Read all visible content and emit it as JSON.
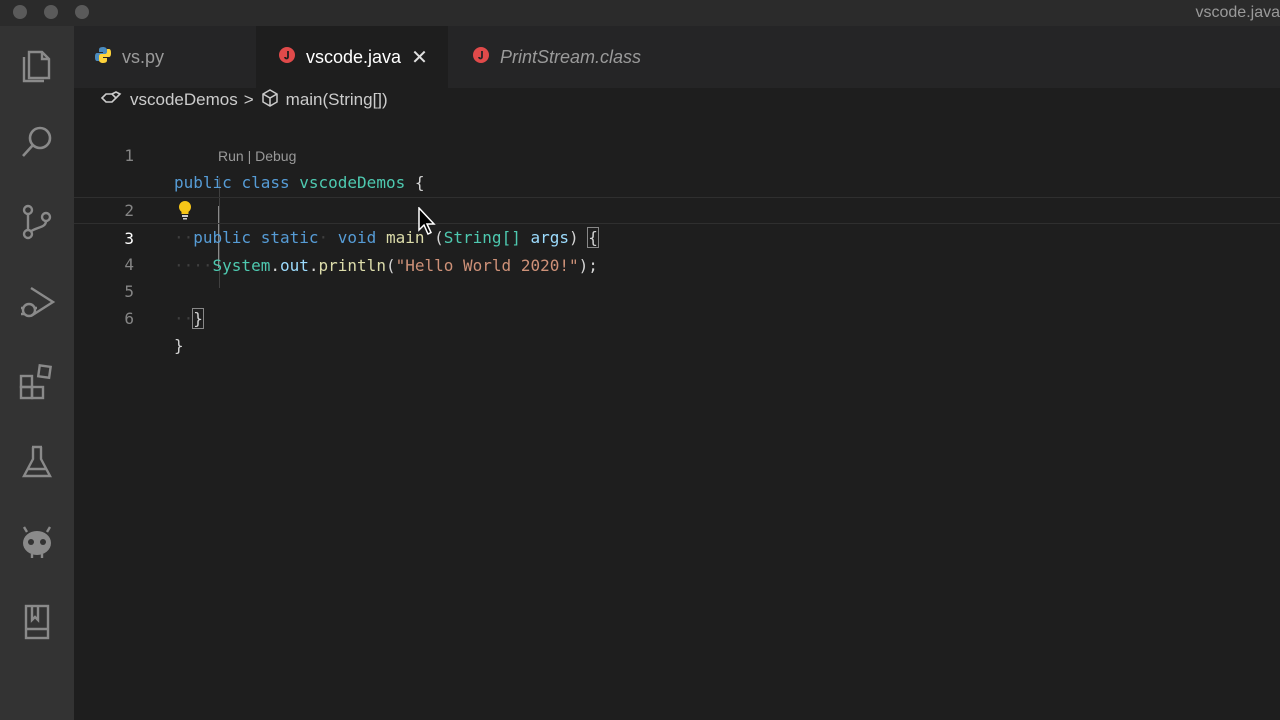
{
  "window": {
    "title": "vscode.java"
  },
  "activity_bar": {
    "icons": [
      "files-icon",
      "search-icon",
      "source-control-icon",
      "run-debug-icon",
      "extensions-icon",
      "testing-icon",
      "robot-icon",
      "book-icon"
    ]
  },
  "tabs": [
    {
      "label": "vs.py",
      "icon": "python-icon",
      "active": false,
      "italic": false
    },
    {
      "label": "vscode.java",
      "icon": "java-icon",
      "active": true,
      "italic": false
    },
    {
      "label": "PrintStream.class",
      "icon": "java-icon",
      "active": false,
      "italic": true
    }
  ],
  "breadcrumb": {
    "class_name": "vscodeDemos",
    "separator": ">",
    "method": "main(String[])"
  },
  "codelens": "Run | Debug",
  "line_numbers": [
    "1",
    "2",
    "3",
    "4",
    "5",
    "6"
  ],
  "code": {
    "l1": {
      "kw1": "public",
      "kw2": "class",
      "cls": "vscodeDemos",
      "brace": "{"
    },
    "l2": {
      "kw1": "public",
      "kw2": "static",
      "kw3": "void",
      "fn": "main",
      "open": "(",
      "type": "String[]",
      "arg": "args",
      "close": ")",
      "brace": "{"
    },
    "l3": {
      "obj": "System",
      "dot1": ".",
      "field": "out",
      "dot2": ".",
      "fn": "println",
      "open": "(",
      "str": "\"Hello World 2020!\"",
      "close": ");"
    },
    "l5": {
      "brace": "}"
    },
    "l6": {
      "brace": "}"
    }
  },
  "colors": {
    "keyword": "#569cd6",
    "type": "#4ec9b0",
    "function": "#dcdcaa",
    "string": "#ce9178",
    "java_icon": "#e04a4a",
    "python_icon": "#4b8bbe",
    "lightbulb": "#f5c518"
  }
}
